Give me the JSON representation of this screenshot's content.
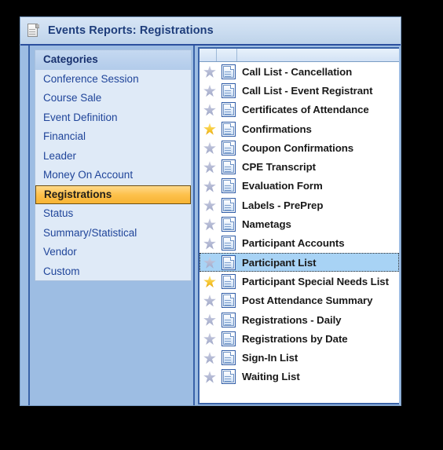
{
  "window": {
    "title": "Events Reports: Registrations",
    "title_icon": "page-icon"
  },
  "sidebar": {
    "header": "Categories",
    "items": [
      {
        "label": "Conference Session",
        "selected": false
      },
      {
        "label": "Course Sale",
        "selected": false
      },
      {
        "label": "Event Definition",
        "selected": false
      },
      {
        "label": "Financial",
        "selected": false
      },
      {
        "label": "Leader",
        "selected": false
      },
      {
        "label": "Money On Account",
        "selected": false
      },
      {
        "label": "Registrations",
        "selected": true
      },
      {
        "label": "Status",
        "selected": false
      },
      {
        "label": "Summary/Statistical",
        "selected": false
      },
      {
        "label": "Vendor",
        "selected": false
      },
      {
        "label": "Custom",
        "selected": false
      }
    ]
  },
  "report_list": {
    "columns": [
      "",
      "",
      ""
    ],
    "rows": [
      {
        "label": "Call List - Cancellation",
        "favorite": false,
        "selected": false,
        "star_icon": "star-icon",
        "doc_icon": "document-icon"
      },
      {
        "label": "Call List - Event Registrant",
        "favorite": false,
        "selected": false,
        "star_icon": "star-icon",
        "doc_icon": "document-icon"
      },
      {
        "label": "Certificates of Attendance",
        "favorite": false,
        "selected": false,
        "star_icon": "star-icon",
        "doc_icon": "document-icon"
      },
      {
        "label": "Confirmations",
        "favorite": true,
        "selected": false,
        "star_icon": "star-icon",
        "doc_icon": "document-icon"
      },
      {
        "label": "Coupon Confirmations",
        "favorite": false,
        "selected": false,
        "star_icon": "star-icon",
        "doc_icon": "document-icon"
      },
      {
        "label": "CPE Transcript",
        "favorite": false,
        "selected": false,
        "star_icon": "star-icon",
        "doc_icon": "document-icon"
      },
      {
        "label": "Evaluation Form",
        "favorite": false,
        "selected": false,
        "star_icon": "star-icon",
        "doc_icon": "document-icon"
      },
      {
        "label": "Labels - PrePrep",
        "favorite": false,
        "selected": false,
        "star_icon": "star-icon",
        "doc_icon": "document-icon"
      },
      {
        "label": "Nametags",
        "favorite": false,
        "selected": false,
        "star_icon": "star-icon",
        "doc_icon": "document-icon"
      },
      {
        "label": "Participant Accounts",
        "favorite": false,
        "selected": false,
        "star_icon": "star-icon",
        "doc_icon": "document-icon"
      },
      {
        "label": "Participant List",
        "favorite": false,
        "selected": true,
        "star_icon": "star-icon",
        "doc_icon": "document-icon"
      },
      {
        "label": "Participant Special Needs List",
        "favorite": true,
        "selected": false,
        "star_icon": "star-icon",
        "doc_icon": "document-icon"
      },
      {
        "label": "Post Attendance Summary",
        "favorite": false,
        "selected": false,
        "star_icon": "star-icon",
        "doc_icon": "document-icon"
      },
      {
        "label": "Registrations - Daily",
        "favorite": false,
        "selected": false,
        "star_icon": "star-icon",
        "doc_icon": "document-icon"
      },
      {
        "label": "Registrations by Date",
        "favorite": false,
        "selected": false,
        "star_icon": "star-icon",
        "doc_icon": "document-icon"
      },
      {
        "label": "Sign-In List",
        "favorite": false,
        "selected": false,
        "star_icon": "star-icon",
        "doc_icon": "document-icon"
      },
      {
        "label": "Waiting List",
        "favorite": false,
        "selected": false,
        "star_icon": "star-icon",
        "doc_icon": "document-icon"
      }
    ]
  },
  "colors": {
    "selection_blue": "#a8d3f5",
    "category_selected_gold": "#fdc04a",
    "favorite_star_gold": "#f5c32a",
    "inactive_star_gray": "#9ea6c6",
    "title_text": "#1e3d7b",
    "panel_blue": "#9dbde3",
    "border_blue": "#3a63a8"
  }
}
